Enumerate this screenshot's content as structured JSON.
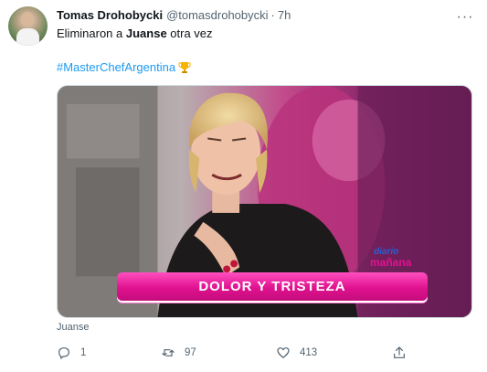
{
  "tweet": {
    "display_name": "Tomas Drohobycki",
    "handle": "@tomasdrohobycki",
    "separator": "·",
    "time": "7h",
    "more_label": "···",
    "text_prefix": "Eliminaron a ",
    "text_bold": "Juanse",
    "text_suffix": " otra vez",
    "hashtag": "#MasterChefArgentina",
    "hashtag_emoji": "trophy-icon"
  },
  "media": {
    "lower_third": "DOLOR Y TRISTEZA",
    "logo_line1": "diario",
    "logo_line2": "mañana"
  },
  "caption": "Juanse",
  "actions": {
    "reply_count": "1",
    "retweet_count": "97",
    "like_count": "413"
  },
  "colors": {
    "accent": "#1d9bf0",
    "secondary_text": "#536471",
    "lower_third_pink": "#e0128f"
  }
}
